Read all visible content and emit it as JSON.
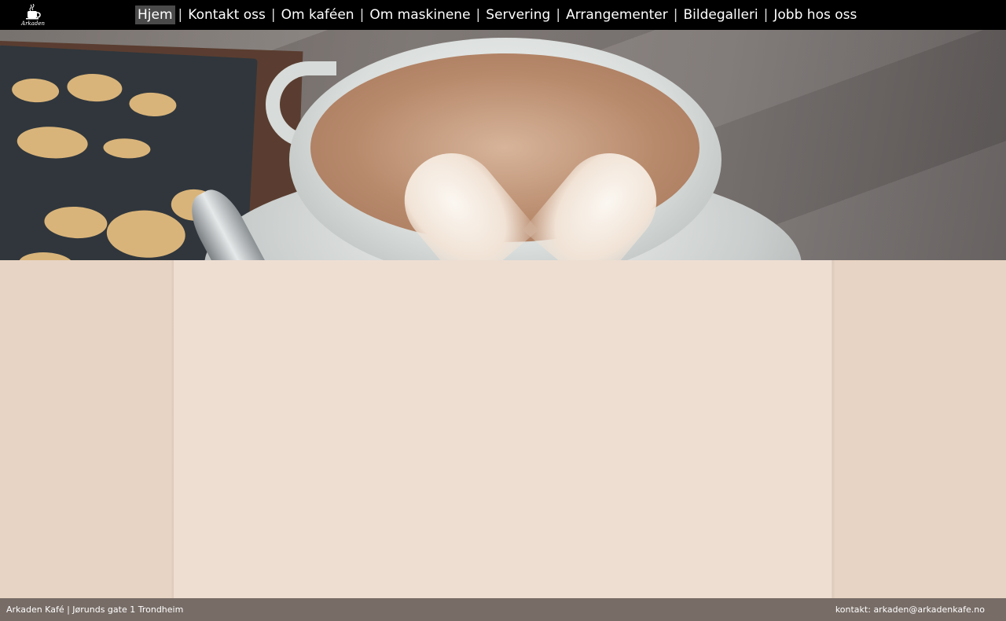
{
  "header": {
    "logo_text": "Arkaden",
    "nav": {
      "items": [
        {
          "label": "Hjem",
          "active": true
        },
        {
          "label": "Kontakt oss",
          "active": false
        },
        {
          "label": "Om kaféen",
          "active": false
        },
        {
          "label": "Om maskinene",
          "active": false
        },
        {
          "label": "Servering",
          "active": false
        },
        {
          "label": "Arrangementer",
          "active": false
        },
        {
          "label": "Bildegalleri",
          "active": false
        },
        {
          "label": "Jobb hos oss",
          "active": false
        }
      ],
      "separator": "|"
    }
  },
  "hero": {
    "icon": "coffee-cup-latte-art-photo"
  },
  "footer": {
    "address": "Arkaden Kafé | Jørunds gate 1 Trondheim",
    "contact_label": "kontakt:",
    "contact_email": "arkaden@arkadenkafe.no"
  },
  "colors": {
    "topbar": "#000000",
    "active_nav": "#4a4a4a",
    "footer": "#776c66",
    "wall": "#e8d4c4",
    "main_panel": "#eeded2"
  }
}
